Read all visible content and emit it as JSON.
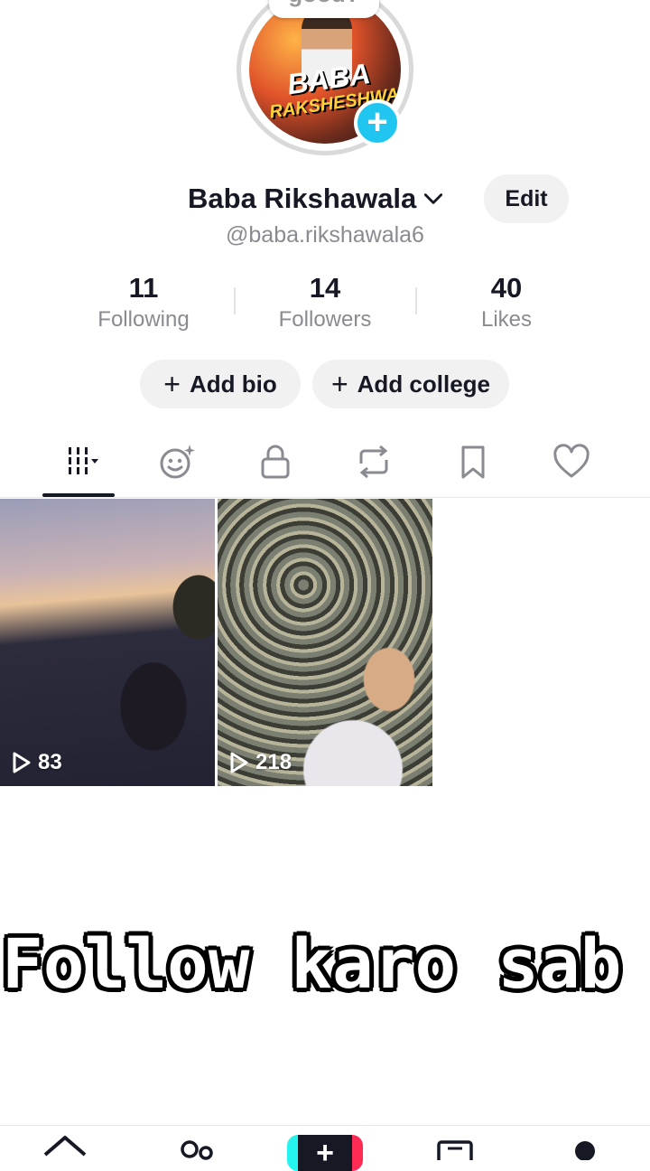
{
  "avatar": {
    "speech_text": "good?",
    "poster_line1": "BABA",
    "poster_line2": "RAKSHESHWALA",
    "plus_label": "+"
  },
  "profile": {
    "name": "Baba Rikshawala",
    "handle": "@baba.rikshawala6",
    "edit_label": "Edit"
  },
  "stats": [
    {
      "value": "11",
      "label": "Following"
    },
    {
      "value": "14",
      "label": "Followers"
    },
    {
      "value": "40",
      "label": "Likes"
    }
  ],
  "actions": {
    "add_bio": "Add bio",
    "add_college": "Add college"
  },
  "tabs": [
    {
      "icon": "grid-icon",
      "active": true
    },
    {
      "icon": "face-sparkle-icon",
      "active": false
    },
    {
      "icon": "lock-icon",
      "active": false
    },
    {
      "icon": "repost-icon",
      "active": false
    },
    {
      "icon": "bookmark-icon",
      "active": false
    },
    {
      "icon": "heart-icon",
      "active": false
    }
  ],
  "videos": [
    {
      "views": "83"
    },
    {
      "views": "218"
    }
  ],
  "overlay_caption": "Follow karo sab",
  "bottom_nav": {
    "create_label": "+",
    "icons": [
      "home-icon",
      "friends-icon",
      "create-icon",
      "inbox-icon",
      "profile-icon"
    ]
  },
  "colors": {
    "accent_cyan": "#20c5f0",
    "text_primary": "#161823",
    "text_secondary": "#8a8b91",
    "pill_bg": "#f1f1f2"
  }
}
